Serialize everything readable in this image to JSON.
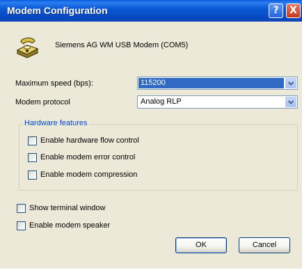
{
  "window": {
    "title": "Modem Configuration",
    "help_glyph": "?",
    "close_glyph": "X"
  },
  "device": {
    "name": "Siemens AG WM USB Modem (COM5)",
    "icon": "modem-icon"
  },
  "max_speed": {
    "label": "Maximum speed (bps):",
    "value": "115200"
  },
  "protocol": {
    "label": "Modem protocol",
    "value": "Analog RLP"
  },
  "hardware": {
    "title": "Hardware features",
    "options": [
      {
        "label": "Enable hardware flow control",
        "checked": false
      },
      {
        "label": "Enable modem error control",
        "checked": false
      },
      {
        "label": "Enable modem compression",
        "checked": false
      }
    ]
  },
  "options": [
    {
      "label": "Show terminal window",
      "checked": false
    },
    {
      "label": "Enable modem speaker",
      "checked": false
    }
  ],
  "buttons": {
    "ok": "OK",
    "cancel": "Cancel"
  },
  "colors": {
    "titlebar": "#0B59D6",
    "dialog_bg": "#ECE9D8",
    "selection": "#316AC5",
    "group_title": "#0046D5"
  }
}
